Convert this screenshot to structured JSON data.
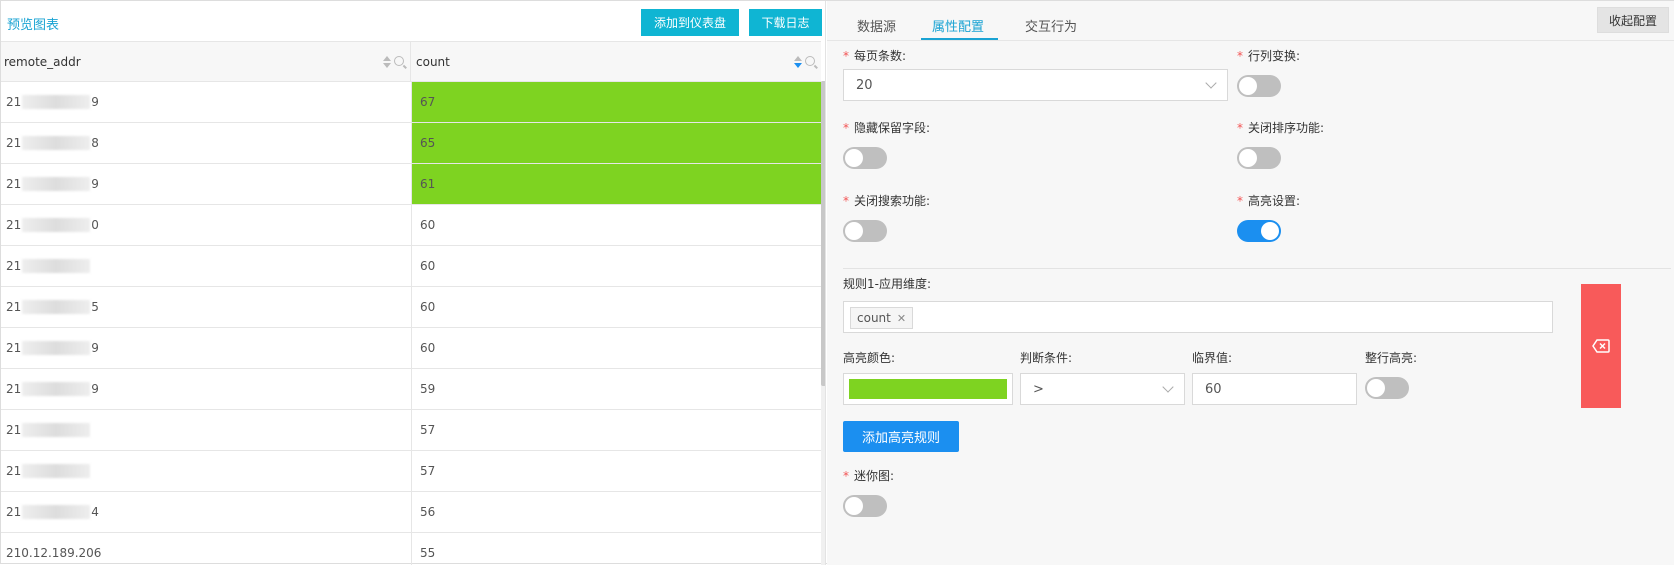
{
  "left": {
    "title": "预览图表",
    "add_dashboard_label": "添加到仪表盘",
    "download_label": "下载日志",
    "columns": [
      "remote_addr",
      "count"
    ],
    "rows": [
      {
        "addr_start": "21",
        "addr_end": "9",
        "count": "67",
        "highlight": true
      },
      {
        "addr_start": "21",
        "addr_end": "8",
        "count": "65",
        "highlight": true
      },
      {
        "addr_start": "21",
        "addr_end": "9",
        "count": "61",
        "highlight": true
      },
      {
        "addr_start": "21",
        "addr_end": "0",
        "count": "60",
        "highlight": false
      },
      {
        "addr_start": "21",
        "addr_end": "",
        "count": "60",
        "highlight": false
      },
      {
        "addr_start": "21",
        "addr_end": "5",
        "count": "60",
        "highlight": false
      },
      {
        "addr_start": "21",
        "addr_end": "9",
        "count": "60",
        "highlight": false
      },
      {
        "addr_start": "21",
        "addr_end": "9",
        "count": "59",
        "highlight": false
      },
      {
        "addr_start": "21",
        "addr_end": "",
        "count": "57",
        "highlight": false
      },
      {
        "addr_start": "21",
        "addr_end": "",
        "count": "57",
        "highlight": false
      },
      {
        "addr_start": "21",
        "addr_end": "4",
        "count": "56",
        "highlight": false
      },
      {
        "addr_start": "210.12.189.206",
        "addr_end": "",
        "count": "55",
        "highlight": false
      }
    ],
    "highlight_color": "#7ed321"
  },
  "right": {
    "tabs": {
      "datasource": "数据源",
      "attributes": "属性配置",
      "interaction": "交互行为"
    },
    "collapse_label": "收起配置",
    "page_size": {
      "label": "每页条数:",
      "value": "20"
    },
    "transpose": {
      "label": "行列变换:",
      "on": false
    },
    "hide_reserved": {
      "label": "隐藏保留字段:",
      "on": false
    },
    "disable_sort": {
      "label": "关闭排序功能:",
      "on": false
    },
    "disable_search": {
      "label": "关闭搜索功能:",
      "on": false
    },
    "highlight": {
      "label": "高亮设置:",
      "on": true
    },
    "rule1": {
      "dimension_label": "规则1-应用维度:",
      "dimension_tag": "count",
      "color_label": "高亮颜色:",
      "color": "#7ed321",
      "condition_label": "判断条件:",
      "condition_value": ">",
      "threshold_label": "临界值:",
      "threshold_value": "60",
      "whole_row_label": "整行高亮:",
      "whole_row_on": false
    },
    "add_rule_label": "添加高亮规则",
    "mini_chart": {
      "label": "迷你图:",
      "on": false
    },
    "required_mark": "*",
    "accent_color": "#1aa3d3",
    "toggle_on_color": "#1b8ff0",
    "delete_color": "#f85a5a"
  }
}
